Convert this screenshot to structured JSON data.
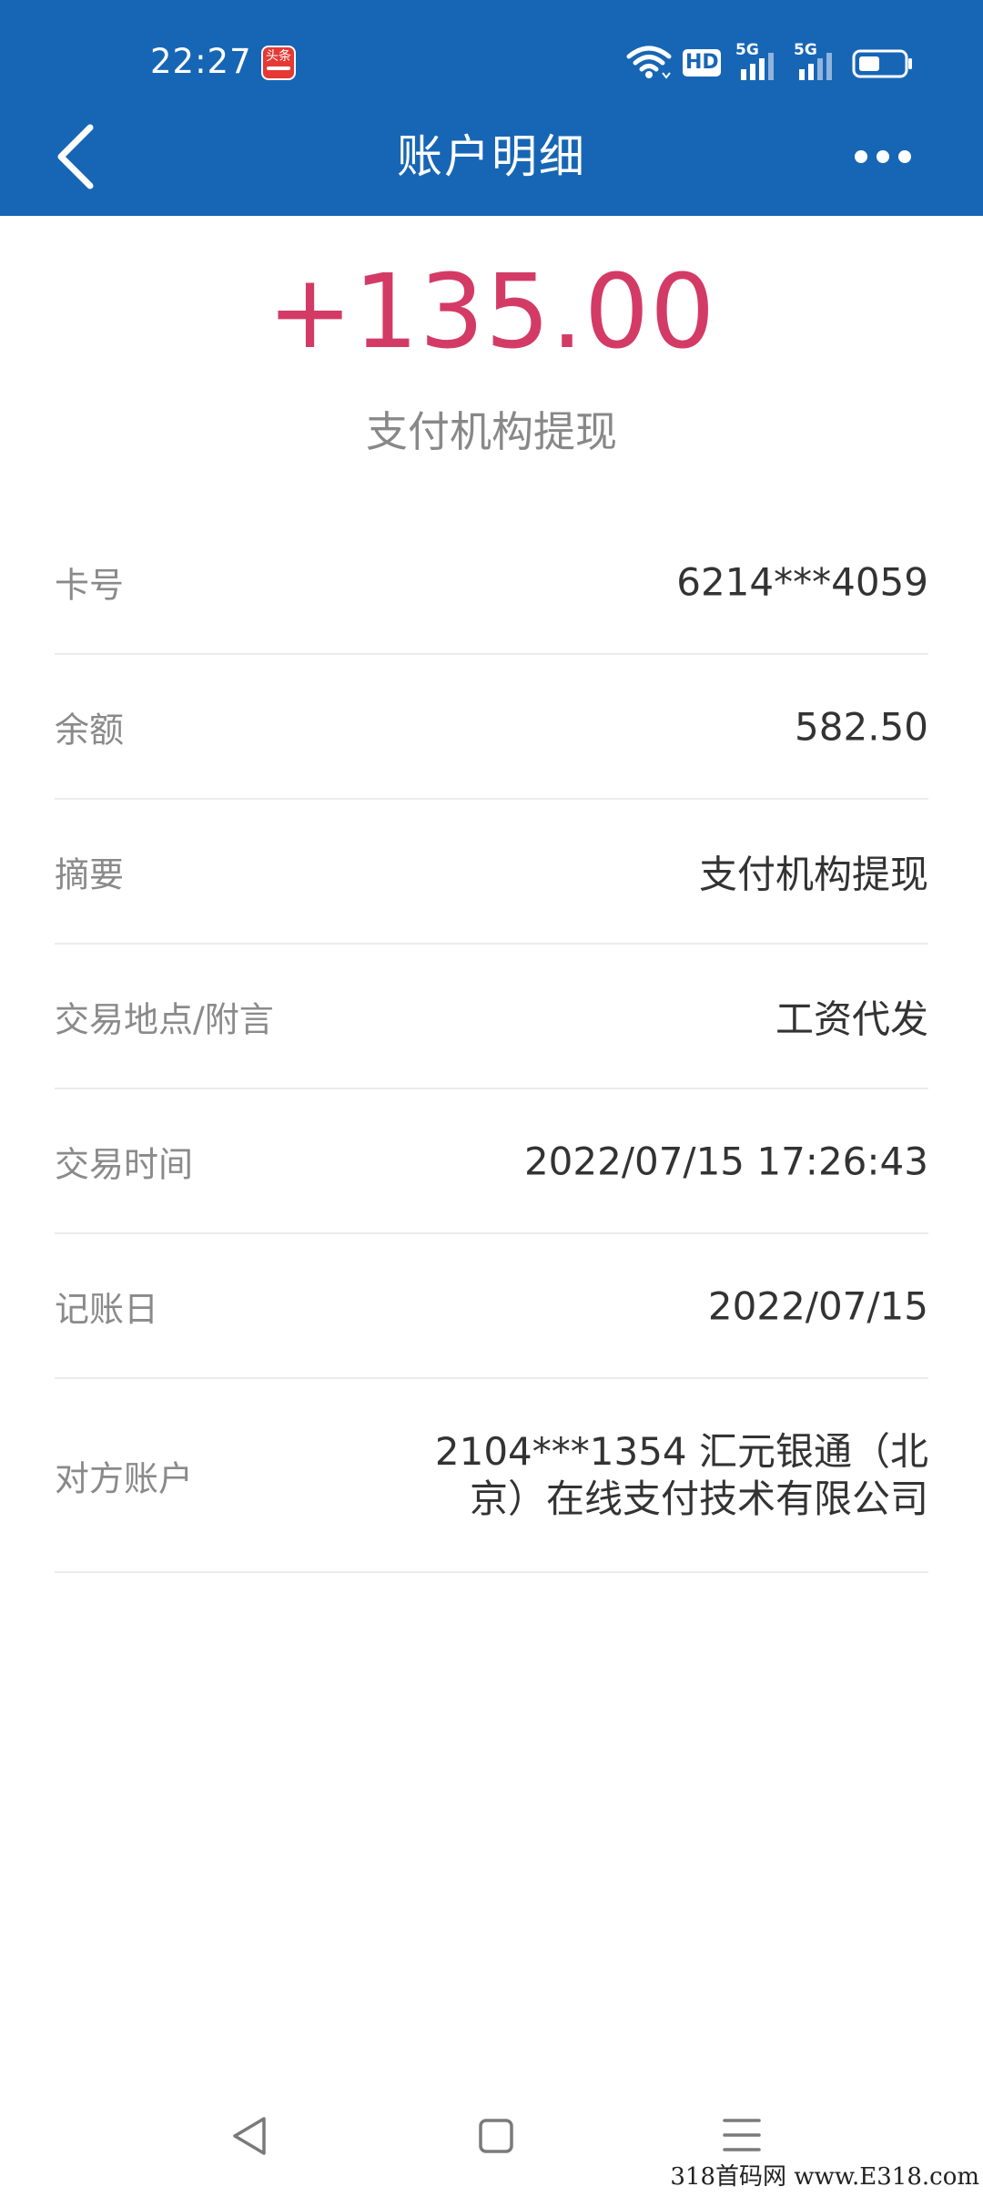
{
  "status_bar": {
    "time": "22:27",
    "toutiao_icon_text": "头条",
    "hd_badge": "HD",
    "network_1": "5G",
    "network_2": "5G",
    "icons": [
      "toutiao-app-icon",
      "wifi-icon",
      "hd-voice-icon",
      "signal-5g-icon",
      "signal-5g-icon",
      "battery-icon"
    ]
  },
  "nav": {
    "title": "账户明细",
    "back_icon": "chevron-left-icon",
    "more_icon": "more-dots-icon"
  },
  "transaction": {
    "amount": "+135.00",
    "description": "支付机构提现",
    "amount_color": "#d33b66"
  },
  "details": [
    {
      "label": "卡号",
      "value": "6214***4059"
    },
    {
      "label": "余额",
      "value": "582.50"
    },
    {
      "label": "摘要",
      "value": "支付机构提现"
    },
    {
      "label": "交易地点/附言",
      "value": "工资代发"
    },
    {
      "label": "交易时间",
      "value": "2022/07/15 17:26:43"
    },
    {
      "label": "记账日",
      "value": "2022/07/15"
    },
    {
      "label": "对方账户",
      "value": "2104***1354 汇元银通（北京）在线支付技术有限公司"
    }
  ],
  "bottom_nav": {
    "icons": [
      "back-triangle-icon",
      "home-square-icon",
      "menu-lines-icon"
    ]
  },
  "watermark": "318首码网 www.E318.com",
  "colors": {
    "header_bg": "#1766b5",
    "amount": "#d33b66",
    "label": "#8a8a8a",
    "value": "#333333"
  }
}
